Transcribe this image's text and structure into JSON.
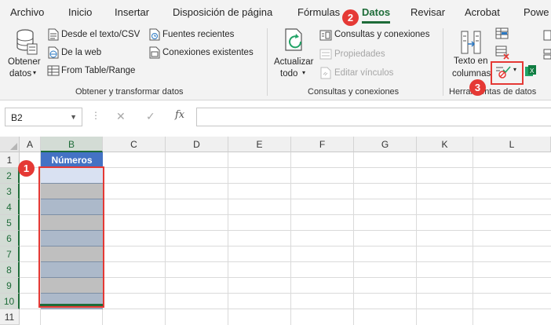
{
  "tabs": [
    {
      "label": "Archivo",
      "active": false
    },
    {
      "label": "Inicio",
      "active": false
    },
    {
      "label": "Insertar",
      "active": false
    },
    {
      "label": "Disposición de página",
      "active": false
    },
    {
      "label": "Fórmulas",
      "active": false
    },
    {
      "label": "Datos",
      "active": true
    },
    {
      "label": "Revisar",
      "active": false
    },
    {
      "label": "Acrobat",
      "active": false
    },
    {
      "label": "Powe",
      "active": false
    }
  ],
  "ribbon": {
    "get_data": {
      "obtener_line1": "Obtener",
      "obtener_line2": "datos",
      "desde_texto": "Desde el texto/CSV",
      "de_la_web": "De la web",
      "from_table": "From Table/Range",
      "fuentes_recientes": "Fuentes recientes",
      "conexiones_existentes": "Conexiones existentes",
      "title": "Obtener y transformar datos"
    },
    "queries": {
      "actualizar_line1": "Actualizar",
      "actualizar_line2": "todo",
      "consultas": "Consultas y conexiones",
      "propiedades": "Propiedades",
      "editar_vinculos": "Editar vínculos",
      "title": "Consultas y conexiones"
    },
    "data_tools": {
      "texto_en_line1": "Texto en",
      "texto_en_line2": "columnas",
      "title": "Herramientas de datos"
    }
  },
  "formula_bar": {
    "name_box": "B2",
    "cancel": "✕",
    "enter": "✓",
    "fx": "fx",
    "formula": ""
  },
  "sheet": {
    "columns": [
      "A",
      "B",
      "C",
      "D",
      "E",
      "F",
      "G",
      "K",
      "L"
    ],
    "rows": [
      "1",
      "2",
      "3",
      "4",
      "5",
      "6",
      "7",
      "8",
      "9",
      "10",
      "11"
    ],
    "selected_column": "B",
    "header_cell": "Números",
    "header_color": "#4472c4",
    "data_fill_colors": [
      "#d9e1f2",
      "#bfbfbf",
      "#acb9ca",
      "#bfbfbf",
      "#acb9ca",
      "#bfbfbf",
      "#acb9ca",
      "#bfbfbf",
      "#acb9ca"
    ]
  },
  "annotations": [
    {
      "number": "1",
      "target": "celdas-B2-B10"
    },
    {
      "number": "2",
      "target": "tab-datos"
    },
    {
      "number": "3",
      "target": "validacion-de-datos-button"
    }
  ],
  "accent_color": "#1e6c39",
  "highlight_color": "#e53935"
}
